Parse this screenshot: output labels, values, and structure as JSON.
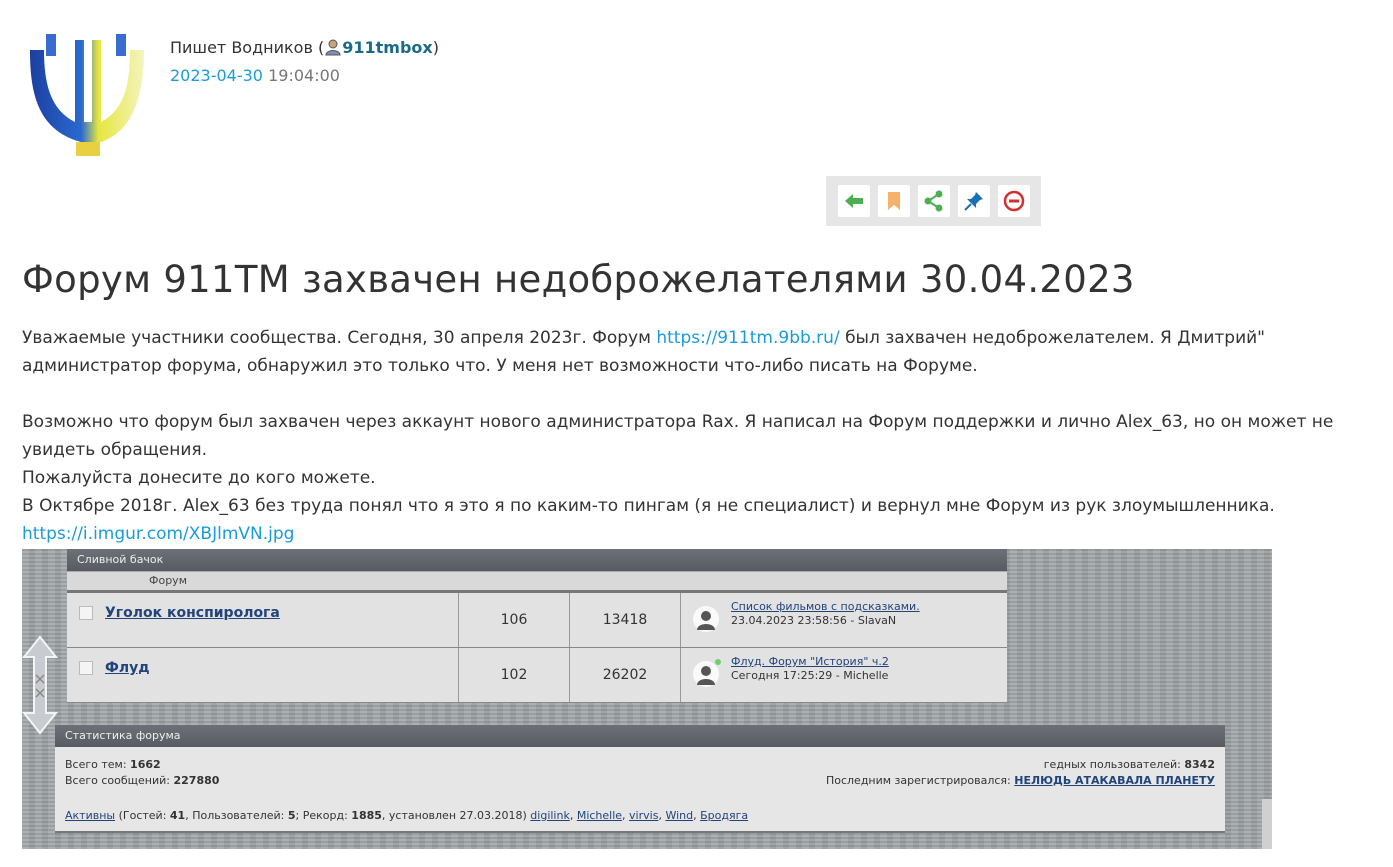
{
  "post": {
    "author_prefix": "Пишет Водников (",
    "author_login": "911tmbox",
    "author_suffix": ")",
    "date": "2023-04-30",
    "time": "19:04:00"
  },
  "toolbar": {
    "buttons": [
      {
        "icon": "reply-arrow-icon",
        "color": "#4caf50"
      },
      {
        "icon": "bookmark-icon",
        "color": "#f5b26b"
      },
      {
        "icon": "share-icon",
        "color": "#4caf50"
      },
      {
        "icon": "pin-icon",
        "color": "#1a6fb5"
      },
      {
        "icon": "block-icon",
        "color": "#d32f2f"
      }
    ]
  },
  "article": {
    "title": "Форум 911TM захвачен недоброжелателями 30.04.2023",
    "p1_before": "Уважаемые участники сообщества. Сегодня, 30 апреля 2023г. Форум ",
    "p1_link": "https://911tm.9bb.ru/",
    "p1_after": " был захвачен недоброжелателем. Я Дмитрий\" администратор форума, обнаружил это только что. У меня нет возможности что-либо писать на Форуме.",
    "p2": "Возможно что форум был захвачен через аккаунт нового администратора Rax. Я написал на Форум поддержки и лично Alex_63, но он может не увидеть обращения.",
    "p3": "Пожалуйста донесите до кого можете.",
    "p4": "В Октябре 2018г. Alex_63 без труда понял что я это я по каким-то пингам (я не специалист) и вернул мне Форум из рук злоумышленника.",
    "image_link": "https://i.imgur.com/XBJlmVN.jpg"
  },
  "screenshot": {
    "section_title": "Сливной бачок",
    "column_header": "Форум",
    "forums": [
      {
        "name": "Уголок конспиролога",
        "topics": "106",
        "posts": "13418",
        "last_title": "Список фильмов с подсказками.",
        "last_meta": "23.04.2023 23:58:56 - SlavaN"
      },
      {
        "name": "Флуд",
        "topics": "102",
        "posts": "26202",
        "last_title": "Флуд. Форум \"История\" ч.2",
        "last_meta": "Сегодня 17:25:29 - Michelle"
      }
    ],
    "stats": {
      "title": "Статистика форума",
      "topics_label": "Всего тем: ",
      "topics_value": "1662",
      "posts_label": "Всего сообщений: ",
      "posts_value": "227880",
      "users_label": "гедных пользователей: ",
      "users_value": "8342",
      "lastreg_label": "Последним зарегистрировался: ",
      "lastreg_value": "НЕЛЮДЬ АТАКАВАЛА ПЛАНЕТУ",
      "active_label": "Активны",
      "guests_prefix": " (Гостей: ",
      "guests": "41",
      "users_prefix": ", Пользователей: ",
      "users": "5",
      "record_prefix": "; Рекорд: ",
      "record": "1885",
      "record_suffix": ", установлен 27.03.2018) ",
      "online_users": [
        "digilink",
        "Michelle",
        "virvis",
        "Wind",
        "Бродяга"
      ]
    }
  }
}
